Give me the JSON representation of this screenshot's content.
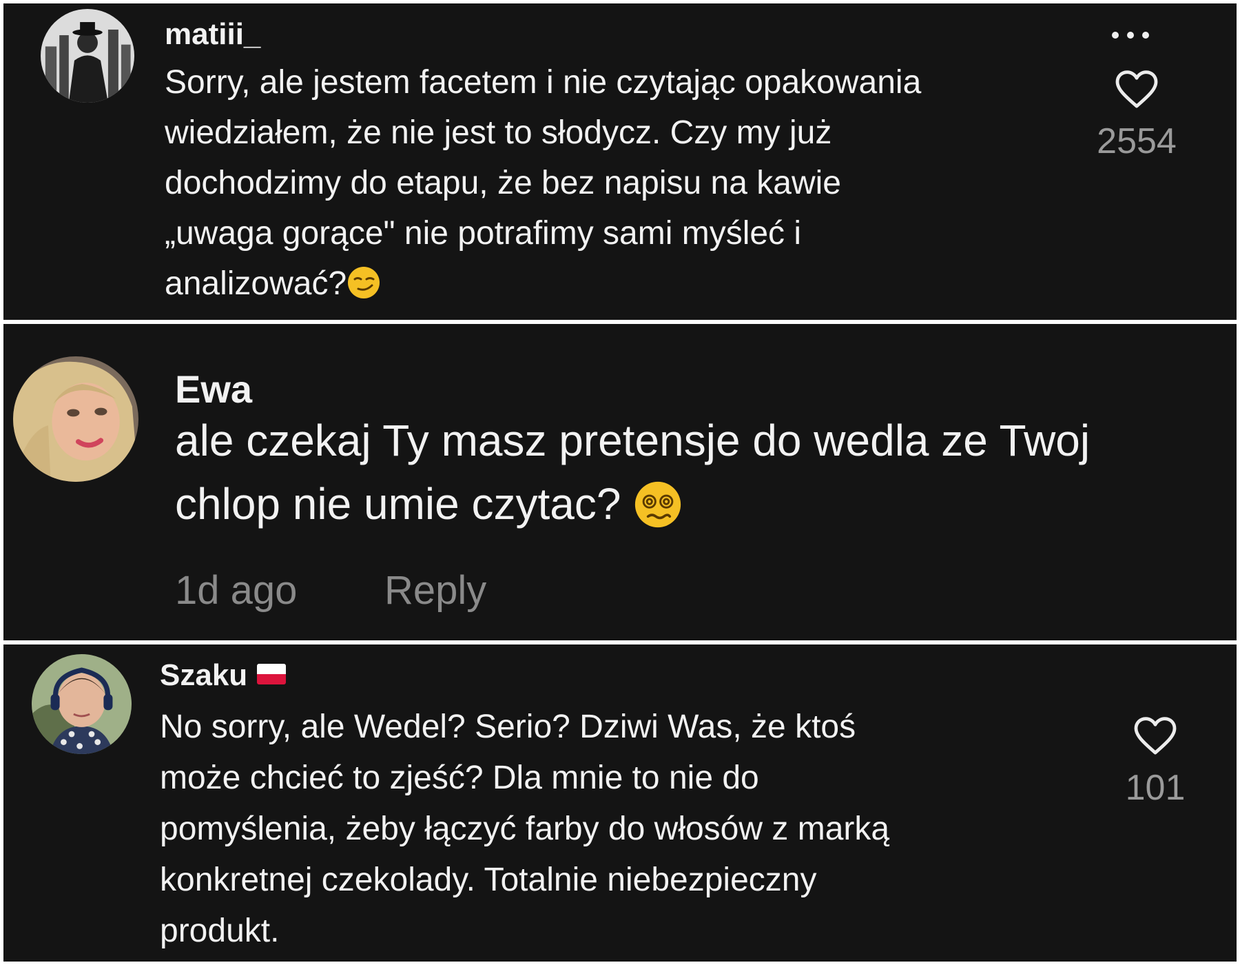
{
  "comments": [
    {
      "username": "matiii_",
      "lines": [
        "Sorry, ale jestem facetem i nie czytając opakowania",
        "wiedziałem, że nie jest to słodycz. Czy my już",
        "dochodzimy do etapu, że bez napisu na kawie",
        "„uwaga gorące\" nie potrafimy sami myśleć i",
        "analizować?"
      ],
      "emoji_icon": "smirking-face-icon",
      "likes": "2554",
      "more_icon": "more-options-icon"
    },
    {
      "username": "Ewa",
      "lines": [
        "ale czekaj Ty masz pretensje do wedla ze Twoj",
        "chlop nie umie czytac?"
      ],
      "emoji_icon": "dizzy-face-icon",
      "time": "1d ago",
      "reply_label": "Reply"
    },
    {
      "username": "Szaku",
      "flag_icon": "poland-flag-icon",
      "lines": [
        "No sorry, ale Wedel? Serio? Dziwi Was, że ktoś",
        "może chcieć to zjeść? Dla mnie to nie do",
        "pomyślenia, żeby łączyć farby do włosów z marką",
        "konkretnej czekolady. Totalnie niebezpieczny",
        "produkt."
      ],
      "likes": "101"
    }
  ],
  "colors": {
    "panel_background": "#141414",
    "separator": "#ffffff",
    "text_primary": "#f2f2f2",
    "text_secondary": "#9a9a9a"
  }
}
